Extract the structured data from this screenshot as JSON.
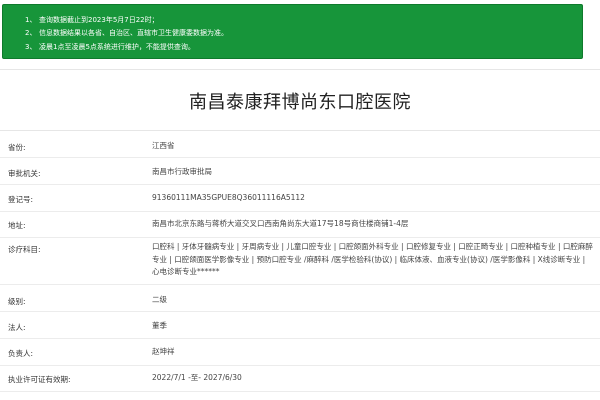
{
  "notice": {
    "lines": [
      {
        "num": "1、",
        "text": "查询数据截止到2023年5月7日22时；"
      },
      {
        "num": "2、",
        "text": "信息数据结果以各省、自治区、直辖市卫生健康委数据为准。"
      },
      {
        "num": "3、",
        "text": "凌晨1点至凌晨5点系统进行维护，不能提供查询。"
      }
    ],
    "background": "#17953a"
  },
  "hospital_name": "南昌泰康拜博尚东口腔医院",
  "fields": [
    {
      "label": "省份:",
      "value": "江西省"
    },
    {
      "label": "审批机关:",
      "value": "南昌市行政审批局"
    },
    {
      "label": "登记号:",
      "value": "91360111MA35GPUE8Q36011116A5112"
    },
    {
      "label": "地址:",
      "value": "南昌市北京东路与蒋桥大道交叉口西南角尚东大道17号18号商住楼商铺1-4层"
    },
    {
      "label": "诊疗科目:",
      "value": "口腔科 | 牙体牙髓病专业 | 牙周病专业 | 儿童口腔专业 | 口腔颌面外科专业 | 口腔修复专业 | 口腔正畸专业 | 口腔种植专业 | 口腔麻醉专业 | 口腔颌面医学影像专业 | 预防口腔专业 /麻醉科 /医学检验科(协议) | 临床体液、血液专业(协议) /医学影像科 | X线诊断专业 | 心电诊断专业******"
    },
    {
      "label": "级别:",
      "value": "二级"
    },
    {
      "label": "法人:",
      "value": "董季"
    },
    {
      "label": "负责人:",
      "value": "赵坤祥"
    },
    {
      "label": "执业许可证有效期:",
      "value": "2022/7/1 -至- 2027/6/30"
    }
  ]
}
